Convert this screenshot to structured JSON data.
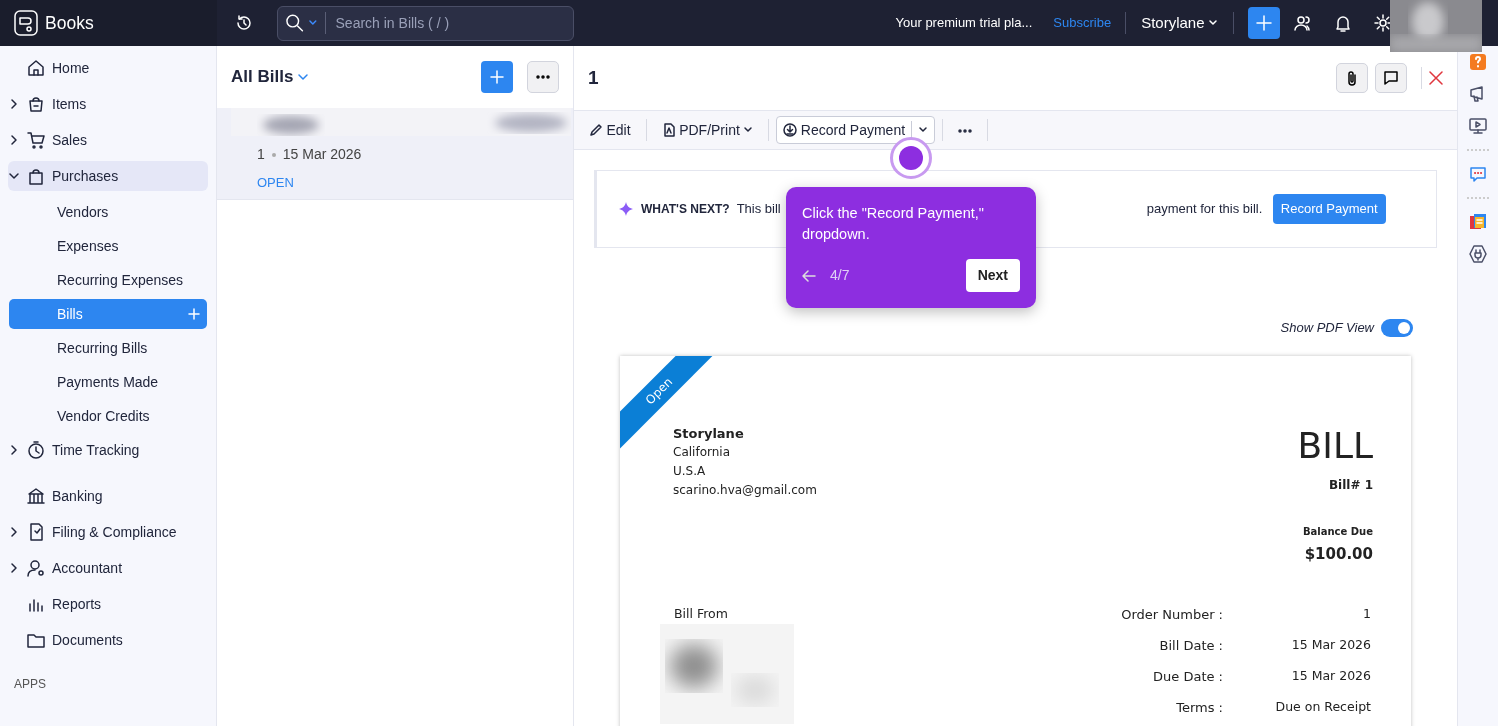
{
  "app": {
    "name": "Books"
  },
  "topbar": {
    "search_placeholder": "Search in Bills ( / )",
    "trial_text": "Your premium trial pla...",
    "subscribe": "Subscribe",
    "org": "Storylane"
  },
  "sidebar": {
    "items": [
      {
        "label": "Home",
        "kind": "link",
        "selected": false
      },
      {
        "label": "Items",
        "kind": "group",
        "expanded": false,
        "selected": false
      },
      {
        "label": "Sales",
        "kind": "group",
        "expanded": false,
        "selected": false
      },
      {
        "label": "Purchases",
        "kind": "group",
        "expanded": true,
        "selected": true,
        "children": [
          {
            "label": "Vendors",
            "selected": false
          },
          {
            "label": "Expenses",
            "selected": false
          },
          {
            "label": "Recurring Expenses",
            "selected": false
          },
          {
            "label": "Bills",
            "selected": true
          },
          {
            "label": "Recurring Bills",
            "selected": false
          },
          {
            "label": "Payments Made",
            "selected": false
          },
          {
            "label": "Vendor Credits",
            "selected": false
          }
        ]
      },
      {
        "label": "Time Tracking",
        "kind": "group",
        "expanded": false,
        "selected": false
      },
      {
        "label": "Banking",
        "kind": "link",
        "selected": false
      },
      {
        "label": "Filing & Compliance",
        "kind": "group",
        "expanded": false,
        "selected": false
      },
      {
        "label": "Accountant",
        "kind": "group",
        "expanded": false,
        "selected": false
      },
      {
        "label": "Reports",
        "kind": "link",
        "selected": false
      },
      {
        "label": "Documents",
        "kind": "link",
        "selected": false
      }
    ],
    "section_label": "APPS"
  },
  "list": {
    "title": "All Bills",
    "rows": [
      {
        "number": "1",
        "date": "15 Mar 2026",
        "status": "OPEN",
        "selected": true
      }
    ]
  },
  "detail": {
    "title": "1",
    "toolbar": [
      {
        "label": "Edit",
        "kind": "edit"
      },
      {
        "label": "PDF/Print",
        "kind": "pdf"
      },
      {
        "label": "Record Payment",
        "kind": "record"
      }
    ],
    "banner": {
      "label": "WHAT'S NEXT?",
      "text_before": "This bill",
      "text_after": "payment for this bill.",
      "button": "Record Payment"
    },
    "pdf_view": {
      "label": "Show PDF View",
      "on": true
    },
    "document": {
      "ribbon": "Open",
      "company": "Storylane",
      "address": [
        "California",
        "U.S.A",
        "scarino.hva@gmail.com"
      ],
      "heading": "BILL",
      "number": "Bill# 1",
      "balance_label": "Balance Due",
      "balance": "$100.00",
      "bill_from": "Bill From",
      "fields": [
        {
          "label": "Order Number :",
          "value": "1"
        },
        {
          "label": "Bill Date :",
          "value": "15 Mar 2026"
        },
        {
          "label": "Due Date :",
          "value": "15 Mar 2026"
        },
        {
          "label": "Terms :",
          "value": "Due on Receipt"
        }
      ]
    }
  },
  "tour": {
    "text": "Click the \"Record Payment,\" dropdown.",
    "step": "4/7",
    "next": "Next"
  }
}
